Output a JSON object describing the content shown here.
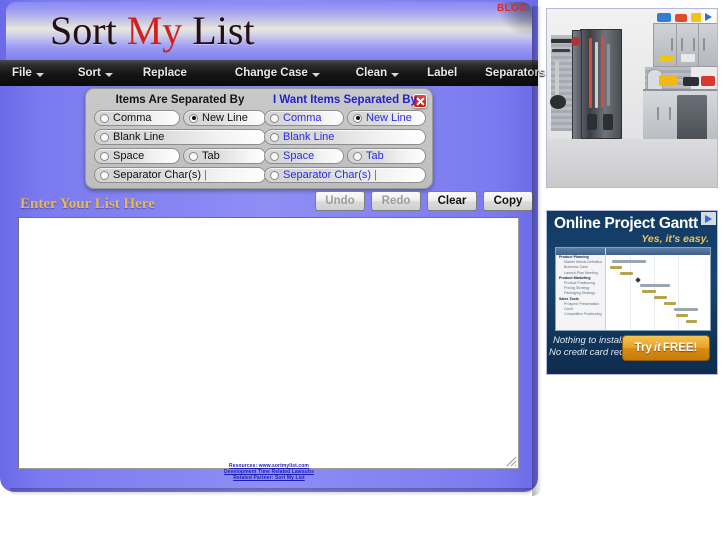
{
  "header": {
    "title_part1": "Sort ",
    "title_part2": "My ",
    "title_part3": "List",
    "blog_label": "BLOG"
  },
  "menubar": {
    "items": [
      {
        "label": "File",
        "has_caret": true
      },
      {
        "label": "Sort",
        "has_caret": true
      },
      {
        "label": "Replace",
        "has_caret": false
      },
      {
        "label": "Change Case",
        "has_caret": true
      },
      {
        "label": "Clean",
        "has_caret": true
      },
      {
        "label": "Label",
        "has_caret": false
      },
      {
        "label": "Separators",
        "has_caret": false
      }
    ]
  },
  "separator_panel": {
    "left": {
      "heading": "Items Are Separated By",
      "options": [
        {
          "label": "Comma",
          "selected": false
        },
        {
          "label": "New Line",
          "selected": true
        },
        {
          "label": "Blank Line",
          "selected": false
        },
        {
          "label": "Space",
          "selected": false
        },
        {
          "label": "Tab",
          "selected": false
        },
        {
          "label": "Separator Char(s)",
          "selected": false
        }
      ],
      "char_input_value": ""
    },
    "right": {
      "heading": "I Want Items Separated By",
      "options": [
        {
          "label": "Comma",
          "selected": false
        },
        {
          "label": "New Line",
          "selected": true
        },
        {
          "label": "Blank Line",
          "selected": false
        },
        {
          "label": "Space",
          "selected": false
        },
        {
          "label": "Tab",
          "selected": false
        },
        {
          "label": "Separator Char(s)",
          "selected": false
        }
      ],
      "char_input_value": ""
    },
    "close_icon": "close-icon"
  },
  "actions": {
    "undo": {
      "label": "Undo",
      "enabled": false
    },
    "redo": {
      "label": "Redo",
      "enabled": false
    },
    "clear": {
      "label": "Clear",
      "enabled": true
    },
    "copy": {
      "label": "Copy",
      "enabled": true
    }
  },
  "list_editor": {
    "label": "Enter Your List Here",
    "value": "",
    "placeholder": ""
  },
  "footer": {
    "links": [
      "Resources: www.sortmylist.com",
      "Development Time Related Lawsuits",
      "Related Partner: Sort My List"
    ]
  },
  "ads": {
    "ad_garage": {
      "name": "garage-storage-ad",
      "adchoices_icon": "adchoices-icon"
    },
    "ad_gantt": {
      "title": "Online Project Gantt",
      "subtitle": "Yes, it's easy.",
      "footer_line1": "Nothing to install.",
      "footer_line2": "No credit card required.",
      "cta_pre": "Try",
      "cta_it": "it",
      "cta_post": "FREE!",
      "adchoices_icon": "adchoices-icon",
      "screenshot": {
        "side_header": "Task Name",
        "tasks": [
          {
            "label": "Product Planning",
            "group": true
          },
          {
            "label": "Market Needs Definition",
            "group": false
          },
          {
            "label": "Business Case",
            "group": false
          },
          {
            "label": "Launch Plan Meeting",
            "group": false
          },
          {
            "label": "Product Marketing",
            "group": true
          },
          {
            "label": "Product Positioning",
            "group": false
          },
          {
            "label": "Pricing Strategy",
            "group": false
          },
          {
            "label": "Packaging Strategy",
            "group": false
          },
          {
            "label": "Sales Tools",
            "group": true
          },
          {
            "label": "Prospect Presentation",
            "group": false
          },
          {
            "label": "Gantt",
            "group": false
          },
          {
            "label": "Competitive Positioning",
            "group": false
          }
        ]
      }
    }
  },
  "colors": {
    "app_background": "#8e8ef5",
    "menubar": "#111111",
    "title_red": "#d2201c",
    "list_label_gold": "#e9b84a",
    "radio_blue_text": "#2b2be0",
    "close_red": "#d42a1f",
    "footer_link": "#1d1db4"
  }
}
